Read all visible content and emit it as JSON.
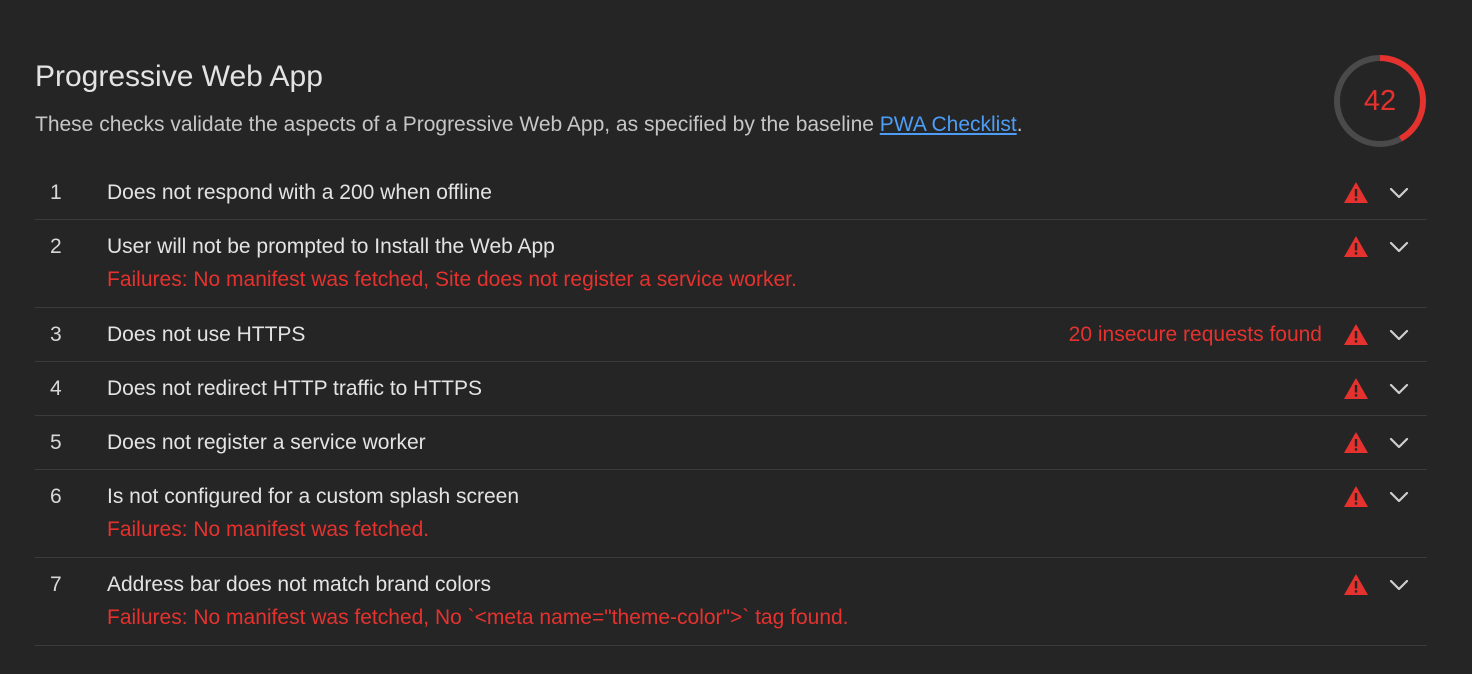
{
  "category": {
    "title": "Progressive Web App",
    "description_prefix": "These checks validate the aspects of a Progressive Web App, as specified by the baseline ",
    "link_text": "PWA Checklist",
    "description_suffix": ".",
    "score": "42",
    "score_fraction": 0.42,
    "score_color": "#e5322f"
  },
  "audits": [
    {
      "num": "1",
      "title": "Does not respond with a 200 when offline",
      "display": "",
      "failure": "",
      "icon": "warning-triangle-icon"
    },
    {
      "num": "2",
      "title": "User will not be prompted to Install the Web App",
      "display": "",
      "failure": "Failures: No manifest was fetched, Site does not register a service worker.",
      "icon": "warning-triangle-icon"
    },
    {
      "num": "3",
      "title": "Does not use HTTPS",
      "display": "20 insecure requests found",
      "failure": "",
      "icon": "warning-triangle-icon"
    },
    {
      "num": "4",
      "title": "Does not redirect HTTP traffic to HTTPS",
      "display": "",
      "failure": "",
      "icon": "warning-triangle-icon"
    },
    {
      "num": "5",
      "title": "Does not register a service worker",
      "display": "",
      "failure": "",
      "icon": "warning-triangle-icon"
    },
    {
      "num": "6",
      "title": "Is not configured for a custom splash screen",
      "display": "",
      "failure": "Failures: No manifest was fetched.",
      "icon": "warning-triangle-icon"
    },
    {
      "num": "7",
      "title": "Address bar does not match brand colors",
      "display": "",
      "failure": "Failures: No manifest was fetched, No `<meta name=\"theme-color\">` tag found.",
      "icon": "warning-triangle-icon"
    }
  ],
  "colors": {
    "background": "#252525",
    "fail": "#e5322f",
    "link": "#4d9df7",
    "divider": "#3b3b3b"
  }
}
